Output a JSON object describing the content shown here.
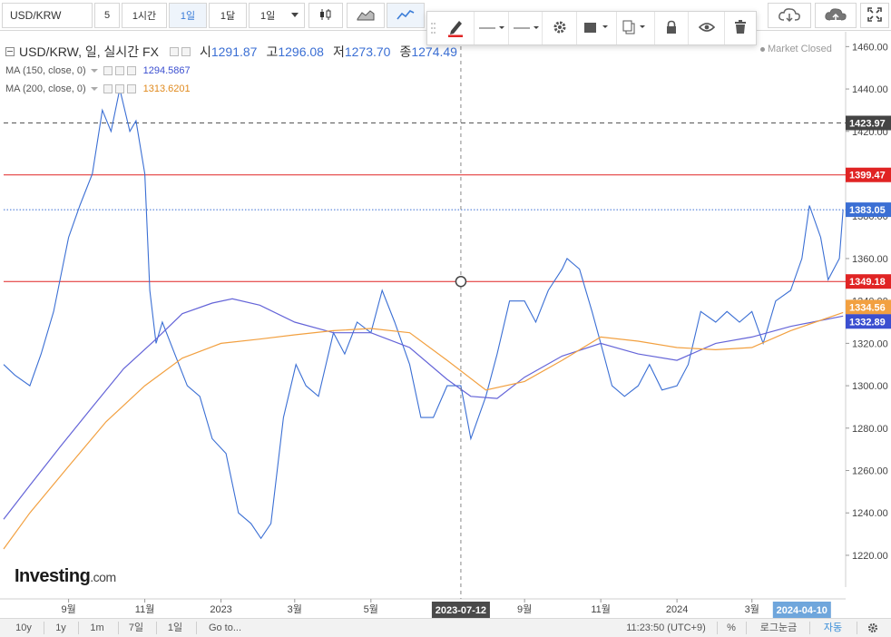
{
  "toolbar": {
    "symbol": "USD/KRW",
    "interval_1": "5",
    "interval_2": "1시간",
    "interval_3": "1일",
    "interval_4": "1달",
    "range_select": "1일"
  },
  "legend": {
    "main_title": "USD/KRW, 일, 실시간 FX",
    "open_label": "시",
    "open_value": "1291.87",
    "high_label": "고",
    "high_value": "1296.08",
    "low_label": "저",
    "low_value": "1273.70",
    "close_label": "종",
    "close_value": "1274.49",
    "ma150_label": "MA (150, close, 0)",
    "ma150_value": "1294.5867",
    "ma200_label": "MA (200, close, 0)",
    "ma200_value": "1313.6201"
  },
  "market_status": "Market Closed",
  "brand": {
    "name": "Investing",
    "suffix": ".com"
  },
  "chart_data": {
    "type": "line",
    "title": "USD/KRW, 일, 실시간 FX",
    "y_ticks": [
      1220,
      1240,
      1260,
      1280,
      1300,
      1320,
      1340,
      1360,
      1380,
      1400,
      1420,
      1440,
      1460
    ],
    "y_tick_labels": [
      "1220.00",
      "1240.00",
      "1260.00",
      "1280.00",
      "1300.00",
      "1320.00",
      "1340.00",
      "1360.00",
      "1380.00",
      "1400.00",
      "1420.00",
      "1440.00",
      "1460.00"
    ],
    "ylim": [
      1205,
      1467
    ],
    "x_tick_labels": [
      "9월",
      "11월",
      "2023",
      "3월",
      "5월",
      "9월",
      "11월",
      "2024",
      "3월"
    ],
    "x_tick_dates": [
      "2022-09-01",
      "2022-11-01",
      "2023-01-01",
      "2023-03-01",
      "2023-05-01",
      "2023-09-01",
      "2023-11-01",
      "2024-01-01",
      "2024-03-01"
    ],
    "xlim": [
      "2022-07-11",
      "2024-05-15"
    ],
    "series": [
      {
        "name": "USD/KRW",
        "color": "#3b6fd4",
        "x": [
          "2022-07-11",
          "2022-07-20",
          "2022-08-01",
          "2022-08-10",
          "2022-08-20",
          "2022-09-01",
          "2022-09-10",
          "2022-09-20",
          "2022-09-28",
          "2022-10-05",
          "2022-10-12",
          "2022-10-20",
          "2022-10-25",
          "2022-11-01",
          "2022-11-05",
          "2022-11-10",
          "2022-11-15",
          "2022-11-25",
          "2022-12-05",
          "2022-12-15",
          "2022-12-25",
          "2023-01-05",
          "2023-01-15",
          "2023-01-25",
          "2023-02-02",
          "2023-02-10",
          "2023-02-20",
          "2023-03-02",
          "2023-03-10",
          "2023-03-20",
          "2023-04-01",
          "2023-04-10",
          "2023-04-20",
          "2023-05-01",
          "2023-05-10",
          "2023-05-20",
          "2023-06-01",
          "2023-06-10",
          "2023-06-20",
          "2023-07-01",
          "2023-07-12",
          "2023-07-20",
          "2023-08-01",
          "2023-08-10",
          "2023-08-20",
          "2023-09-01",
          "2023-09-10",
          "2023-09-20",
          "2023-10-01",
          "2023-10-05",
          "2023-10-15",
          "2023-10-25",
          "2023-11-01",
          "2023-11-10",
          "2023-11-20",
          "2023-12-01",
          "2023-12-10",
          "2023-12-20",
          "2024-01-01",
          "2024-01-10",
          "2024-01-20",
          "2024-02-01",
          "2024-02-10",
          "2024-02-20",
          "2024-03-01",
          "2024-03-10",
          "2024-03-20",
          "2024-04-01",
          "2024-04-10",
          "2024-04-16",
          "2024-04-25",
          "2024-05-01",
          "2024-05-10",
          "2024-05-13"
        ],
        "y": [
          1310,
          1305,
          1300,
          1315,
          1335,
          1370,
          1385,
          1400,
          1430,
          1420,
          1440,
          1420,
          1425,
          1400,
          1345,
          1320,
          1330,
          1315,
          1300,
          1295,
          1275,
          1268,
          1240,
          1235,
          1228,
          1235,
          1285,
          1310,
          1300,
          1295,
          1325,
          1315,
          1330,
          1325,
          1345,
          1330,
          1310,
          1285,
          1285,
          1300,
          1300,
          1275,
          1295,
          1315,
          1340,
          1340,
          1330,
          1345,
          1355,
          1360,
          1355,
          1335,
          1320,
          1300,
          1295,
          1300,
          1310,
          1298,
          1300,
          1310,
          1335,
          1330,
          1335,
          1330,
          1335,
          1320,
          1340,
          1345,
          1360,
          1385,
          1370,
          1350,
          1360,
          1383.05
        ]
      },
      {
        "name": "MA (150, close, 0)",
        "color": "#6464d8",
        "x": [
          "2022-07-11",
          "2022-08-01",
          "2022-08-25",
          "2022-09-20",
          "2022-10-15",
          "2022-11-10",
          "2022-12-01",
          "2022-12-25",
          "2023-01-10",
          "2023-02-01",
          "2023-03-01",
          "2023-04-01",
          "2023-05-01",
          "2023-06-01",
          "2023-07-01",
          "2023-07-20",
          "2023-08-10",
          "2023-09-01",
          "2023-10-01",
          "2023-11-01",
          "2023-12-01",
          "2024-01-01",
          "2024-02-01",
          "2024-03-01",
          "2024-04-01",
          "2024-05-13"
        ],
        "y": [
          1237,
          1253,
          1271,
          1290,
          1308,
          1322,
          1334,
          1339,
          1341,
          1338,
          1330,
          1325,
          1325,
          1318,
          1303,
          1295,
          1294,
          1304,
          1314,
          1320,
          1315,
          1312,
          1320,
          1323,
          1328,
          1332.89
        ]
      },
      {
        "name": "MA (200, close, 0)",
        "color": "#f2a040",
        "x": [
          "2022-07-11",
          "2022-08-01",
          "2022-09-01",
          "2022-10-01",
          "2022-11-01",
          "2022-12-01",
          "2023-01-01",
          "2023-02-01",
          "2023-03-01",
          "2023-04-01",
          "2023-05-01",
          "2023-06-01",
          "2023-07-01",
          "2023-08-01",
          "2023-09-01",
          "2023-10-01",
          "2023-11-01",
          "2023-12-01",
          "2024-01-01",
          "2024-02-01",
          "2024-03-01",
          "2024-04-01",
          "2024-05-13"
        ],
        "y": [
          1223,
          1240,
          1262,
          1283,
          1300,
          1313,
          1320,
          1322,
          1324,
          1326,
          1327,
          1325,
          1312,
          1298,
          1302,
          1312,
          1323,
          1321,
          1318,
          1317,
          1318,
          1326,
          1334.56
        ]
      }
    ],
    "crosshair": {
      "x": "2023-07-12",
      "y": 1349.18,
      "date_label": "2023-07-12"
    },
    "hover_date_label": "2024-04-10",
    "horizontal_lines": [
      {
        "name": "dashed-1423",
        "value": 1423.97,
        "label": "1423.97",
        "color": "#555555",
        "style": "dashed"
      },
      {
        "name": "red-1399",
        "value": 1399.47,
        "label": "1399.47",
        "color": "#e02424",
        "style": "solid"
      },
      {
        "name": "last-price",
        "value": 1383.05,
        "label": "1383.05",
        "color": "#3b6fd4",
        "style": "dotted"
      },
      {
        "name": "red-1349",
        "value": 1349.18,
        "label": "1349.18",
        "color": "#e02424",
        "style": "solid"
      }
    ],
    "price_badges": [
      {
        "value": 1334.56,
        "label": "1334.56",
        "color": "#f2a040"
      },
      {
        "value": 1332.89,
        "label": "1332.89",
        "color": "#3b4fd0"
      }
    ]
  },
  "bottom": {
    "r1": "10y",
    "r2": "1y",
    "r3": "1m",
    "r4": "7일",
    "r5": "1일",
    "goto": "Go to...",
    "clock": "11:23:50 (UTC+9)",
    "pct": "%",
    "log": "로그눈금",
    "auto": "자동"
  }
}
